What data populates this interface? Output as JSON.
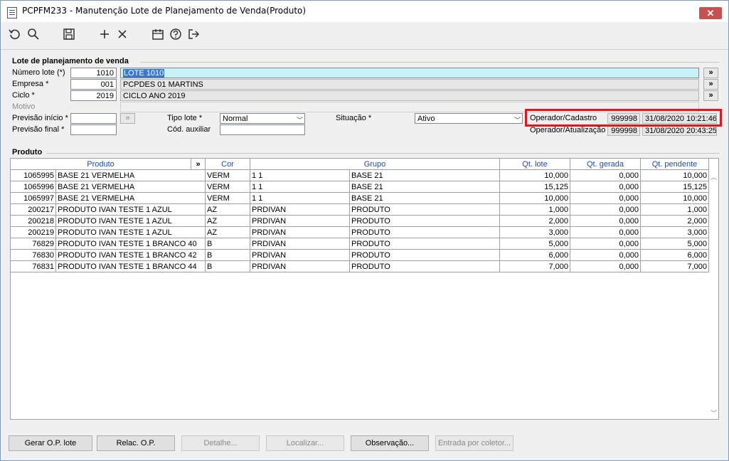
{
  "window": {
    "title": "PCPFM233 - Manutenção Lote de Planejamento de Venda(Produto)",
    "close_label": "✕"
  },
  "toolbar": {
    "icons": [
      "undo-icon",
      "search-icon",
      "save-icon",
      "add-icon",
      "delete-icon",
      "calendar-icon",
      "help-icon",
      "exit-icon"
    ]
  },
  "lote": {
    "section_title": "Lote de planejamento de venda",
    "numero_label": "Número lote (*)",
    "numero_value": "1010",
    "numero_desc": "LOTE 1010",
    "empresa_label": "Empresa *",
    "empresa_value": "001",
    "empresa_desc": "PCPDES 01 MARTINS",
    "ciclo_label": "Ciclo *",
    "ciclo_value": "2019",
    "ciclo_desc": "CICLO ANO 2019",
    "motivo_label": "Motivo",
    "prev_inicio_label": "Previsão início *",
    "prev_inicio_value": "",
    "prev_final_label": "Previsão final *",
    "prev_final_value": "",
    "tipo_label": "Tipo lote *",
    "tipo_value": "Normal",
    "cod_aux_label": "Cód. auxiliar",
    "cod_aux_value": "",
    "situacao_label": "Situação *",
    "situacao_value": "Ativo",
    "lookup_label": "»",
    "op_cad_label": "Operador/Cadastro",
    "op_cad_id": "999998",
    "op_cad_date": "31/08/2020 10:21:46",
    "op_atu_label": "Operador/Atualização",
    "op_atu_id": "999998",
    "op_atu_date": "31/08/2020 20:43:25"
  },
  "produto": {
    "section_title": "Produto",
    "columns": [
      "Produto",
      "»",
      "Cor",
      "Grupo",
      "Qt. lote",
      "Qt. gerada",
      "Qt. pendente"
    ],
    "rows": [
      [
        "1065995",
        "BASE 21 VERMELHA",
        "VERM",
        "1 1",
        "BASE 21",
        "10,000",
        "0,000",
        "10,000"
      ],
      [
        "1065996",
        "BASE 21 VERMELHA",
        "VERM",
        "1 1",
        "BASE 21",
        "15,125",
        "0,000",
        "15,125"
      ],
      [
        "1065997",
        "BASE 21 VERMELHA",
        "VERM",
        "1 1",
        "BASE 21",
        "10,000",
        "0,000",
        "10,000"
      ],
      [
        "200217",
        "PRODUTO IVAN TESTE 1 AZUL",
        "AZ",
        "PRDIVAN",
        "PRODUTO",
        "1,000",
        "0,000",
        "1,000"
      ],
      [
        "200218",
        "PRODUTO IVAN TESTE 1 AZUL",
        "AZ",
        "PRDIVAN",
        "PRODUTO",
        "2,000",
        "0,000",
        "2,000"
      ],
      [
        "200219",
        "PRODUTO IVAN TESTE 1 AZUL",
        "AZ",
        "PRDIVAN",
        "PRODUTO",
        "3,000",
        "0,000",
        "3,000"
      ],
      [
        "76829",
        "PRODUTO IVAN TESTE 1 BRANCO 40",
        "B",
        "PRDIVAN",
        "PRODUTO",
        "5,000",
        "0,000",
        "5,000"
      ],
      [
        "76830",
        "PRODUTO IVAN TESTE 1 BRANCO 42",
        "B",
        "PRDIVAN",
        "PRODUTO",
        "6,000",
        "0,000",
        "6,000"
      ],
      [
        "76831",
        "PRODUTO IVAN TESTE 1 BRANCO 44",
        "B",
        "PRDIVAN",
        "PRODUTO",
        "7,000",
        "0,000",
        "7,000"
      ]
    ]
  },
  "buttons": {
    "gerar": "Gerar O.P. lote",
    "relac": "Relac. O.P.",
    "detalhe": "Detalhe...",
    "localizar": "Localizar...",
    "observacao": "Observação...",
    "entrada": "Entrada por coletor..."
  },
  "colors": {
    "highlight_box": "#e8141c",
    "header_text": "#1d4bb5",
    "selection": "#3a78c9"
  }
}
